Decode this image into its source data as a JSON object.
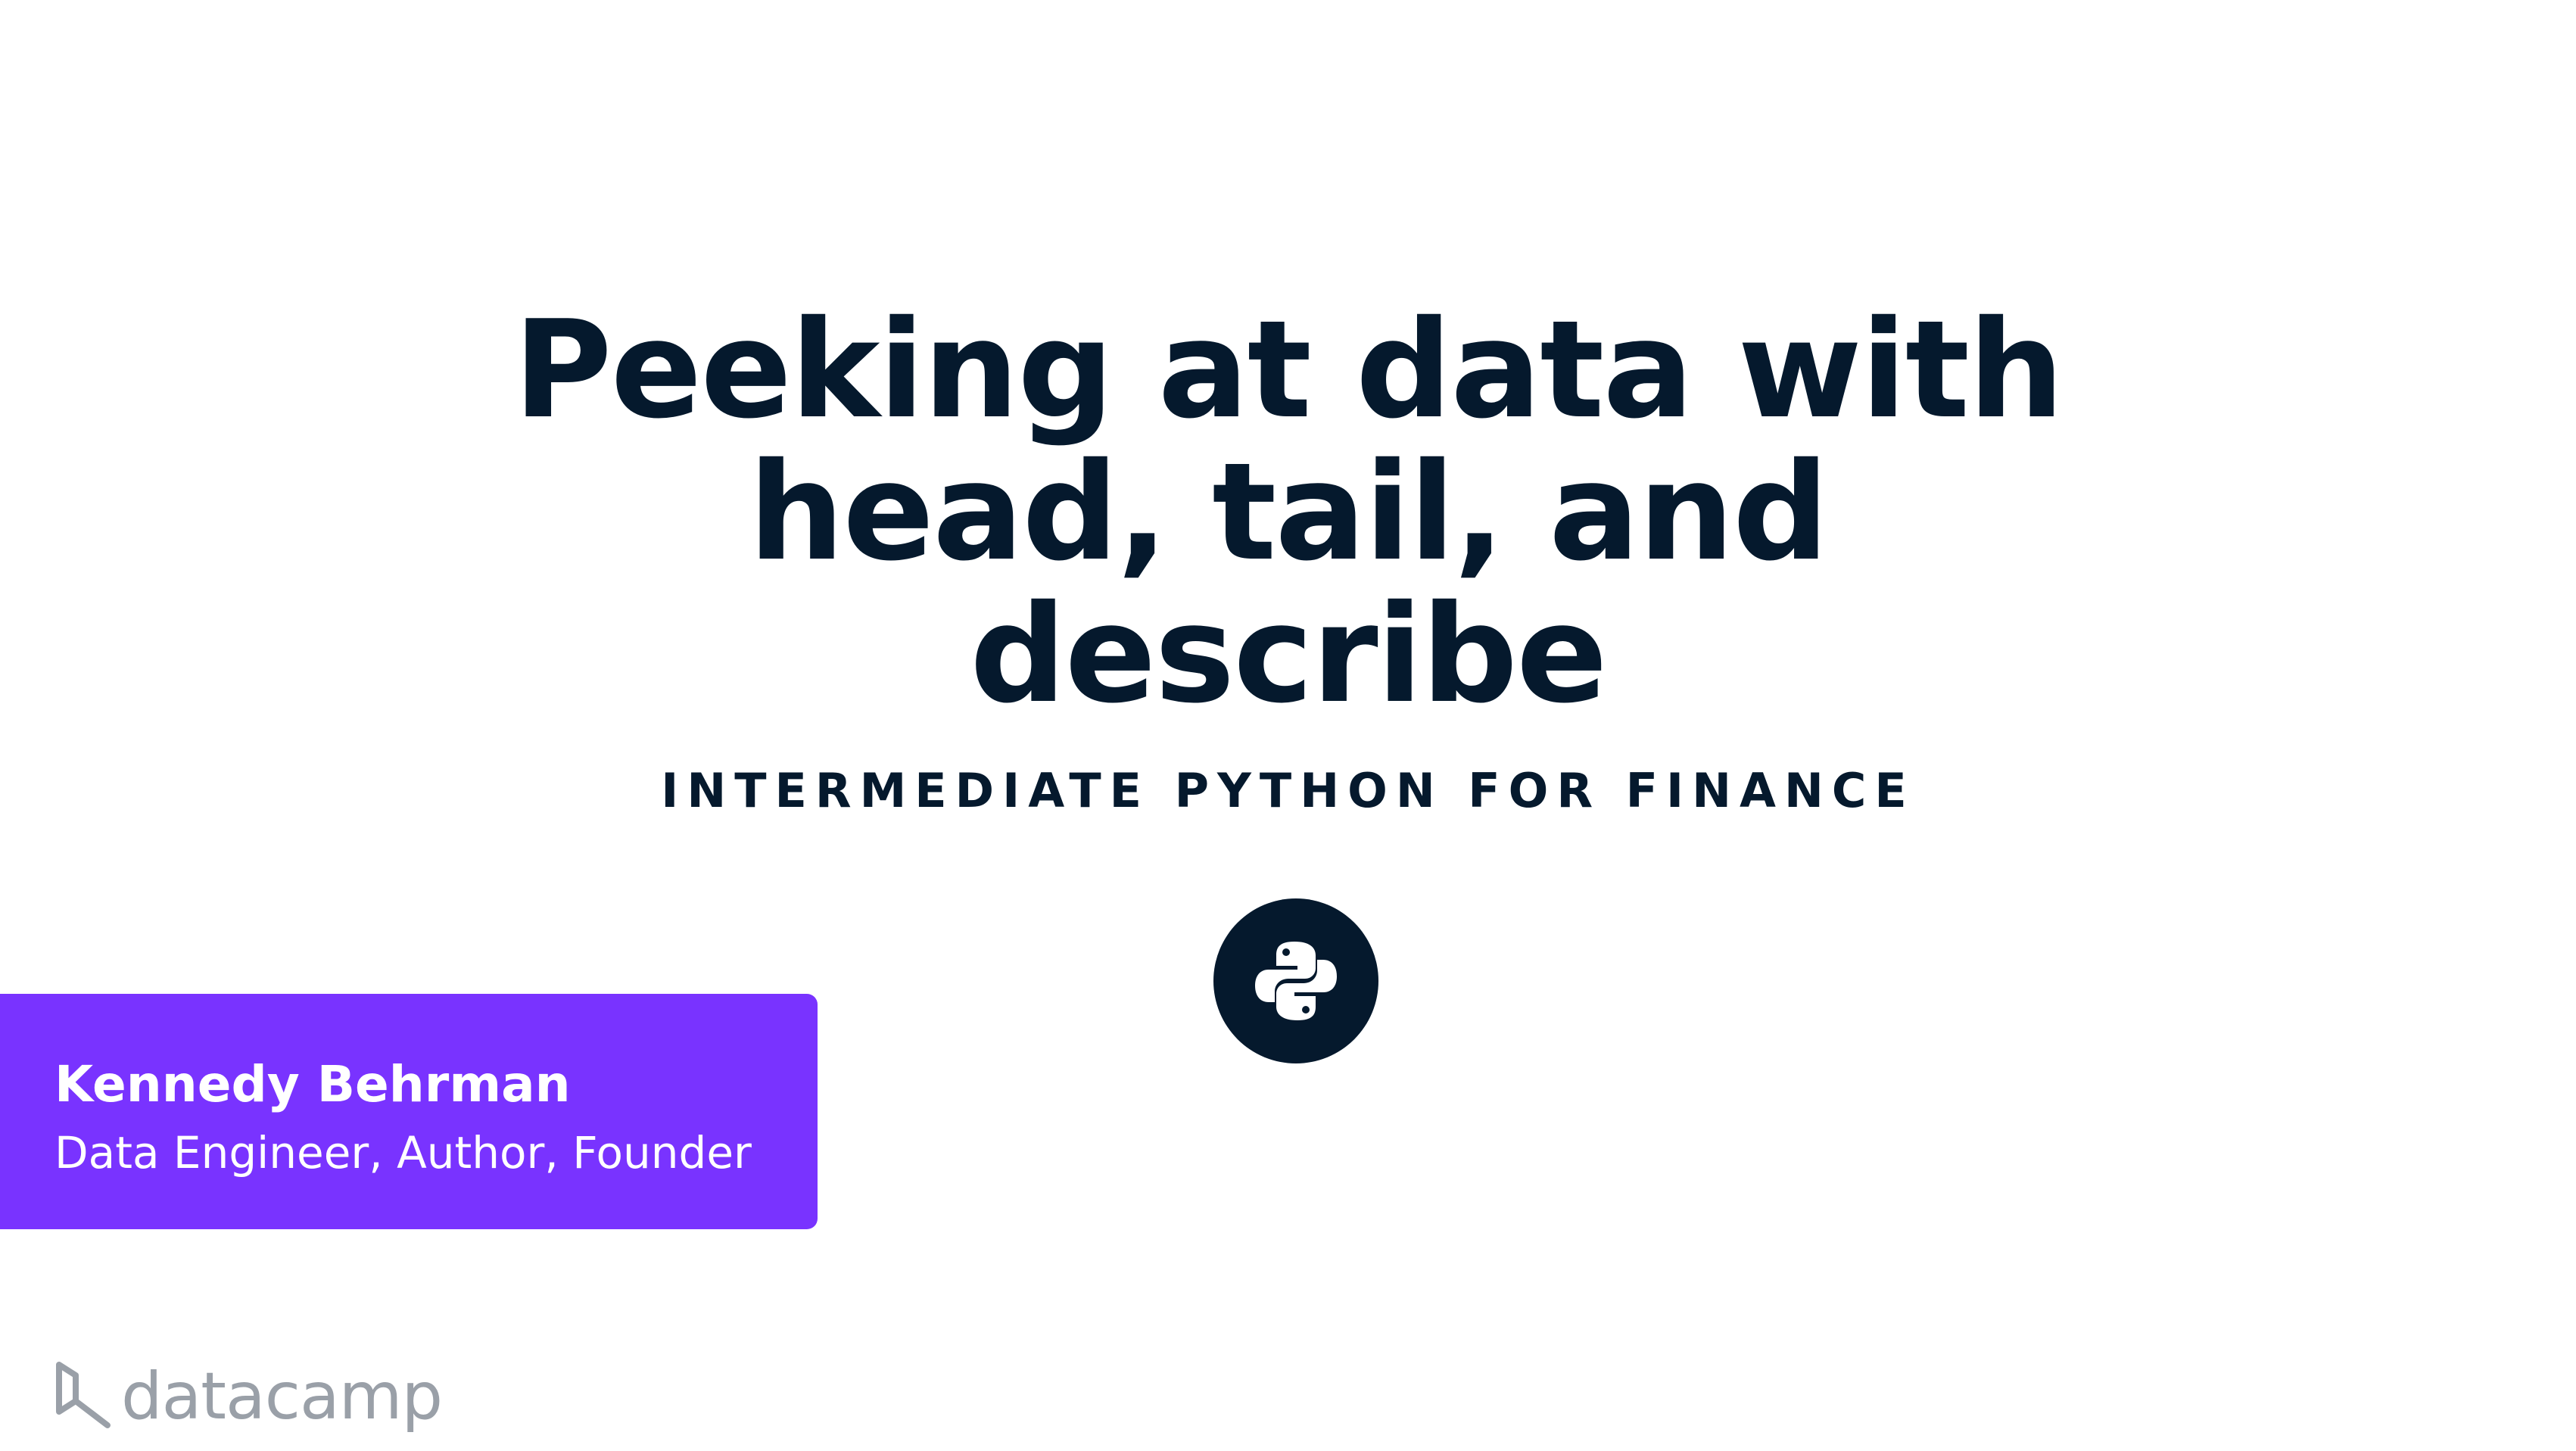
{
  "slide": {
    "title_lines": [
      "Peeking at data with",
      "head, tail, and",
      "describe"
    ],
    "course": "INTERMEDIATE PYTHON FOR FINANCE",
    "badge_icon": "python-icon"
  },
  "author": {
    "name": "Kennedy Behrman",
    "role": "Data Engineer, Author, Founder"
  },
  "brand": {
    "logo_text": "datacamp",
    "logo_icon": "datacamp-logo-icon"
  },
  "colors": {
    "navy": "#05192d",
    "purple": "#7933ff",
    "logo_gray": "#9aa0a8"
  }
}
